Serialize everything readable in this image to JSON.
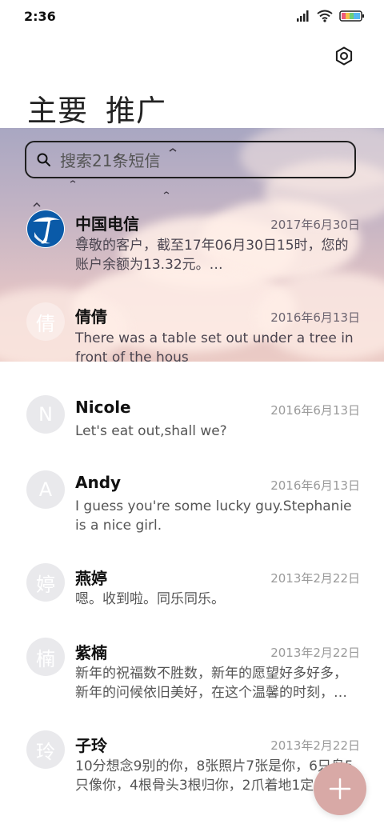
{
  "status_bar": {
    "time": "2:36"
  },
  "tabs": [
    {
      "label": "主要"
    },
    {
      "label": "推广"
    }
  ],
  "search": {
    "placeholder": "搜索21条短信"
  },
  "conversations": [
    {
      "name": "中国电信",
      "date": "2017年6月30日",
      "preview": "尊敬的客户，截至17年06月30日15时，您的账户余额为13.32元。…",
      "avatar": "china-telecom-logo"
    },
    {
      "name": "倩倩",
      "date": "2016年6月13日",
      "preview": "There was a table set out under a tree in front of the hous",
      "avatar": "倩"
    },
    {
      "name": "Nicole",
      "date": "2016年6月13日",
      "preview": "Let's eat out,shall we?",
      "avatar": "N"
    },
    {
      "name": "Andy",
      "date": "2016年6月13日",
      "preview": "I guess you're some lucky guy.Stephanie is a nice girl.",
      "avatar": "A"
    },
    {
      "name": "燕婷",
      "date": "2013年2月22日",
      "preview": "嗯。收到啦。同乐同乐。",
      "avatar": "婷"
    },
    {
      "name": "紫楠",
      "date": "2013年2月22日",
      "preview": "新年的祝福数不胜数，新年的愿望好多好多，新年的问候依旧美好，在这个温馨的时刻，…",
      "avatar": "楠"
    },
    {
      "name": "子玲",
      "date": "2013年2月22日",
      "preview": "10分想念9别的你，8张照片7张是你，6只鸟5只像你，4根骨头3根归你，2爪着地1定是你",
      "avatar": "玲"
    }
  ],
  "colors": {
    "fab": "#d8a9a6",
    "avatar_bg": "#e9e9ec"
  }
}
